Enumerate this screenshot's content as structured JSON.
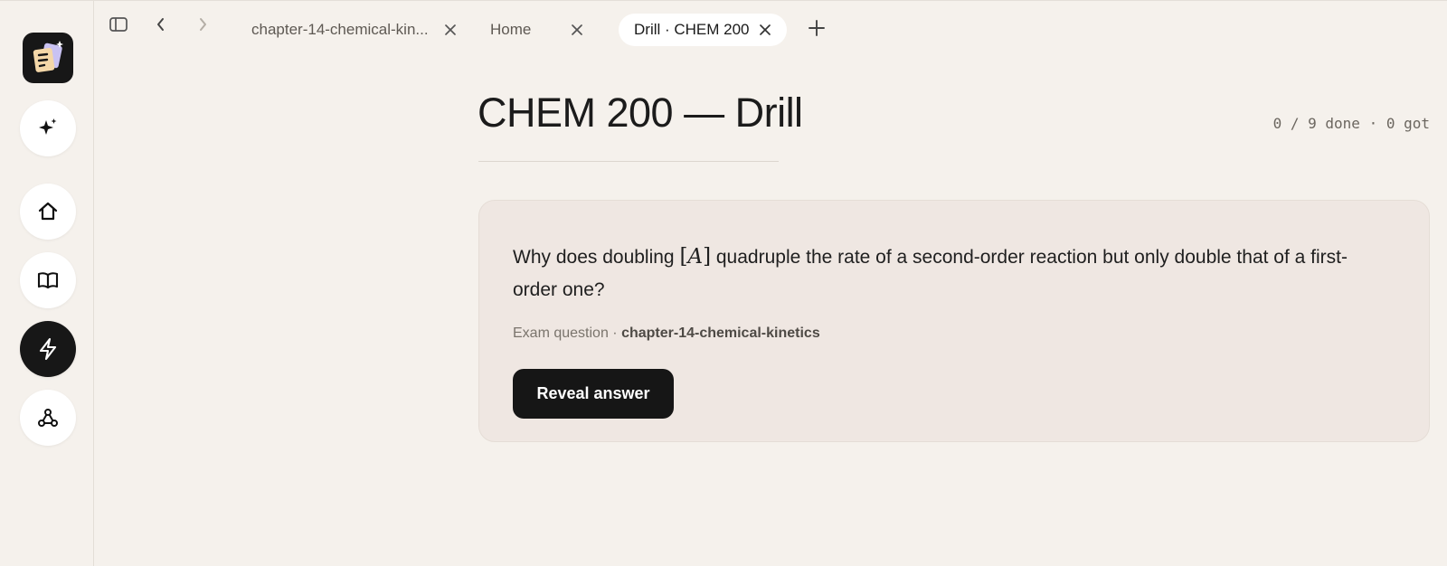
{
  "tabs": [
    {
      "label": "chapter-14-chemical-kin...",
      "active": false
    },
    {
      "label": "Home",
      "active": false
    },
    {
      "label": "Drill · CHEM 200",
      "active": true
    }
  ],
  "page": {
    "title": "CHEM 200 — Drill",
    "progress": "0 / 9 done · 0 got"
  },
  "card": {
    "question_before": "Why does doubling ",
    "math_open": "[",
    "math_var": "A",
    "math_close": "]",
    "question_after": " quadruple the rate of a second-order reaction but only double that of a first-order one?",
    "source_prefix": "Exam question · ",
    "source_name": "chapter-14-chemical-kinetics",
    "reveal_label": "Reveal answer"
  },
  "colors": {
    "background": "#f5f1ec",
    "card_background": "#efe7e2",
    "primary_button": "#161616",
    "active_tab": "#ffffff"
  },
  "icons": {
    "rail": [
      "app-logo",
      "sparkle-icon",
      "home-icon",
      "book-icon",
      "lightning-icon",
      "graph-icon"
    ],
    "tabbar": [
      "sidebar-toggle-icon",
      "back-icon",
      "forward-icon",
      "close-icon",
      "plus-icon"
    ]
  }
}
